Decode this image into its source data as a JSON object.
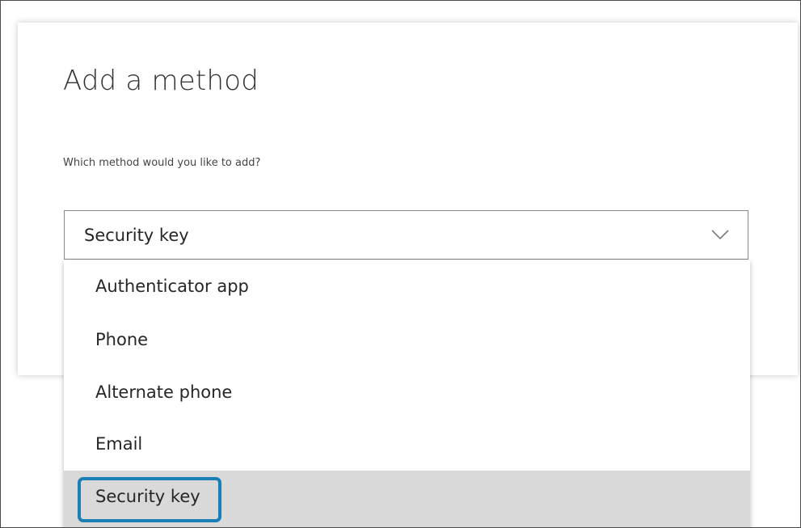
{
  "dialog": {
    "title": "Add a method",
    "question": "Which method would you like to add?"
  },
  "select": {
    "selected_value": "Security key",
    "chevron_icon": "chevron-down-icon",
    "options": [
      {
        "label": "Authenticator app"
      },
      {
        "label": "Phone"
      },
      {
        "label": "Alternate phone"
      },
      {
        "label": "Email"
      },
      {
        "label": "Security key",
        "selected": true
      }
    ]
  },
  "colors": {
    "highlight": "#d9d9d9",
    "focus_ring": "#1a7fb5",
    "text": "#262626"
  }
}
